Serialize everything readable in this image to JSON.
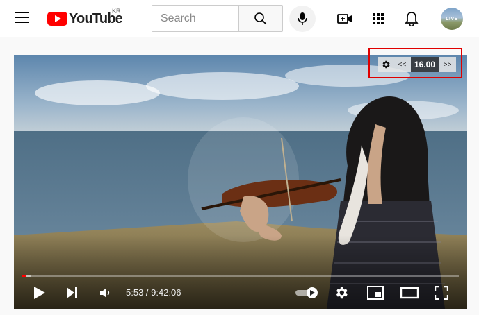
{
  "header": {
    "logo_text": "YouTube",
    "region": "KR",
    "search_placeholder": "Search",
    "avatar_text": "LIVE"
  },
  "icons": {
    "menu": "hamburger-menu-icon",
    "search": "search-icon",
    "mic": "microphone-icon",
    "create": "create-video-icon",
    "apps": "apps-grid-icon",
    "notifications": "bell-icon"
  },
  "speed_control": {
    "decrease_label": "<<",
    "value": "16.00",
    "increase_label": ">>"
  },
  "player": {
    "time_display": "5:53 / 9:42:06",
    "progress_fraction": 0.0101,
    "accent_color": "#ff0000"
  },
  "colors": {
    "brand_red": "#ff0000",
    "highlight": "#e00000"
  }
}
